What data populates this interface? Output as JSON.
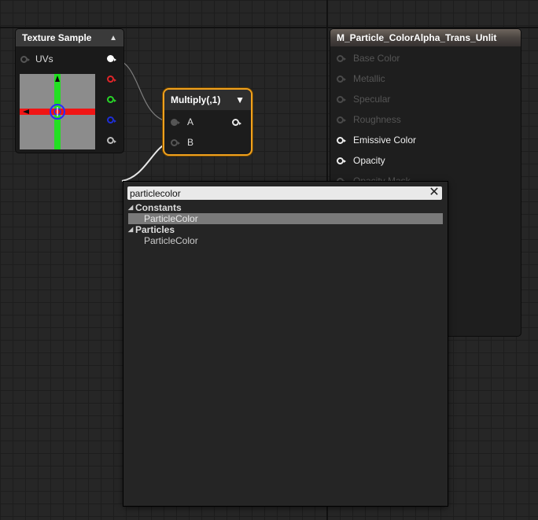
{
  "texture_sample": {
    "title": "Texture Sample",
    "input_pin": "UVs"
  },
  "multiply": {
    "title": "Multiply(,1)",
    "inputs": [
      "A",
      "B"
    ]
  },
  "material": {
    "title": "M_Particle_ColorAlpha_Trans_Unlit",
    "inputs": [
      {
        "label": "Base Color",
        "enabled": false
      },
      {
        "label": "Metallic",
        "enabled": false
      },
      {
        "label": "Specular",
        "enabled": false
      },
      {
        "label": "Roughness",
        "enabled": false
      },
      {
        "label": "Emissive Color",
        "enabled": true
      },
      {
        "label": "Opacity",
        "enabled": true
      },
      {
        "label": "Opacity Mask",
        "enabled": false
      }
    ]
  },
  "search": {
    "value": "particlecolor",
    "categories": [
      {
        "label": "Constants",
        "items": [
          "ParticleColor"
        ]
      },
      {
        "label": "Particles",
        "items": [
          "ParticleColor"
        ]
      }
    ]
  },
  "colors": {
    "selected_outline": "#f0a11e",
    "pin_red": "#e0252a",
    "pin_green": "#28d428",
    "pin_blue": "#1e2fd8"
  }
}
